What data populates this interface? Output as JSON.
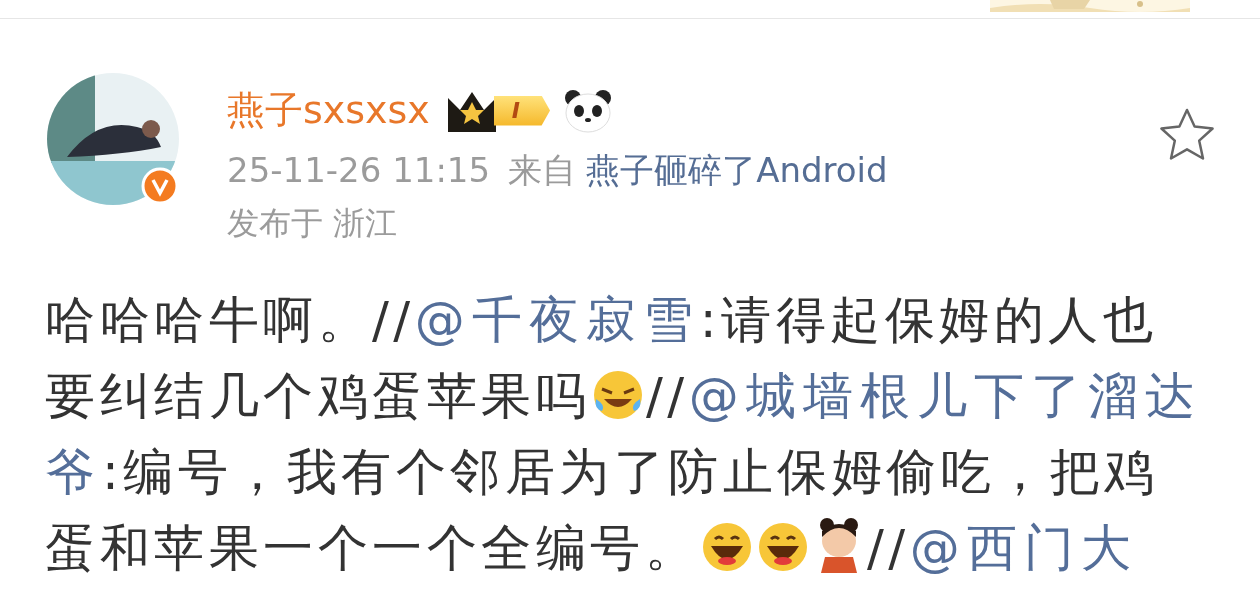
{
  "post": {
    "author": {
      "name": "燕子sxsxsx",
      "level_badge": "I",
      "verified": true
    },
    "time": "25-11-26 11:15",
    "source_prefix": "来自",
    "source": "燕子砸碎了Android",
    "location": "发布于 浙江",
    "favorited": false,
    "body": [
      {
        "kind": "text",
        "text": "哈哈哈牛啊。//"
      },
      {
        "kind": "mention",
        "text": "@千夜寂雪"
      },
      {
        "kind": "text",
        "text": ":请得起保姆的人也要纠结几个鸡蛋苹果吗"
      },
      {
        "kind": "tears"
      },
      {
        "kind": "text",
        "text": "//"
      },
      {
        "kind": "mention",
        "text": "@城墙根儿下了溜达"
      },
      {
        "kind": "mention",
        "text": "爷"
      },
      {
        "kind": "text",
        "text": ":编号，我有个邻居为了防止保姆偷吃，把鸡蛋和苹果一个一个全编号。"
      },
      {
        "kind": "grin"
      },
      {
        "kind": "grin"
      },
      {
        "kind": "sticker"
      },
      {
        "kind": "text",
        "text": "//"
      },
      {
        "kind": "mention",
        "text": "@西门大"
      }
    ]
  }
}
